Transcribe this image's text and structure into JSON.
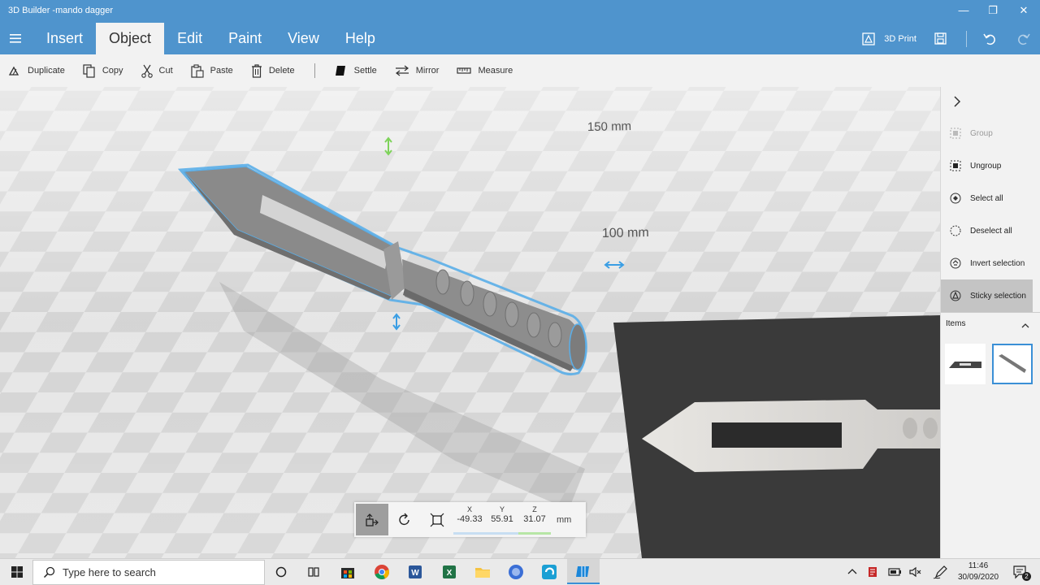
{
  "window": {
    "title": "3D Builder -mando dagger",
    "controls": {
      "minimize": "—",
      "maximize": "❐",
      "close": "✕"
    }
  },
  "menu": {
    "tabs": [
      {
        "label": "Insert"
      },
      {
        "label": "Object",
        "active": true
      },
      {
        "label": "Edit"
      },
      {
        "label": "Paint"
      },
      {
        "label": "View"
      },
      {
        "label": "Help"
      }
    ],
    "print_label": "3D Print"
  },
  "toolbar": {
    "duplicate": "Duplicate",
    "copy": "Copy",
    "cut": "Cut",
    "paste": "Paste",
    "delete": "Delete",
    "settle": "Settle",
    "mirror": "Mirror",
    "measure": "Measure"
  },
  "viewport": {
    "grid_label_1": "150 mm",
    "grid_label_2": "100 mm"
  },
  "panel": {
    "group": "Group",
    "ungroup": "Ungroup",
    "select_all": "Select all",
    "deselect_all": "Deselect all",
    "invert_selection": "Invert selection",
    "sticky_selection": "Sticky selection",
    "items_label": "Items"
  },
  "transform": {
    "x_label": "X",
    "x_value": "-49.33",
    "y_label": "Y",
    "y_value": "55.91",
    "z_label": "Z",
    "z_value": "31.07",
    "unit": "mm"
  },
  "taskbar": {
    "search_placeholder": "Type here to search",
    "time": "11:46",
    "date": "30/09/2020",
    "notification_count": "2"
  },
  "colors": {
    "accent": "#4f94cd",
    "selection": "#5aaee8",
    "x_axis": "#c7def2",
    "z_axis": "#b7e6a6"
  }
}
